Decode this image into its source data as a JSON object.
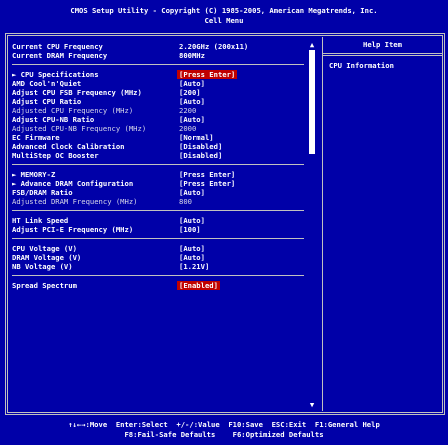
{
  "header": {
    "title": "CMOS Setup Utility - Copyright (C) 1985-2005, American Megatrends, Inc.",
    "subtitle": "Cell Menu"
  },
  "info_rows": [
    {
      "label": "Current CPU Frequency",
      "value": "2.20GHz (200x11)"
    },
    {
      "label": "Current DRAM Frequency",
      "value": "800MHz"
    }
  ],
  "group1": [
    {
      "label": "► CPU Specifications",
      "value": "[Press Enter]",
      "highlight": true
    },
    {
      "label": "AMD Cool'n'Quiet",
      "value": "[Auto]"
    },
    {
      "label": "Adjust CPU FSB Frequency (MHz)",
      "value": "[200]"
    },
    {
      "label": "Adjust CPU Ratio",
      "value": "[Auto]"
    },
    {
      "label": "Adjusted CPU Frequency (MHz)",
      "value": "2200",
      "dim": true
    },
    {
      "label": "Adjust CPU-NB Ratio",
      "value": "[Auto]"
    },
    {
      "label": "Adjusted CPU-NB Frequency (MHz)",
      "value": "2000",
      "dim": true
    },
    {
      "label": "EC Firmware",
      "value": "[Normal]"
    },
    {
      "label": "Advanced Clock Calibration",
      "value": "[Disabled]"
    },
    {
      "label": "MultiStep OC Booster",
      "value": "[Disabled]"
    }
  ],
  "group2": [
    {
      "label": "► MEMORY-Z",
      "value": "[Press Enter]"
    },
    {
      "label": "► Advance DRAM Configuration",
      "value": "[Press Enter]"
    },
    {
      "label": "FSB/DRAM Ratio",
      "value": "[Auto]"
    },
    {
      "label": "Adjusted DRAM Frequency (MHz)",
      "value": "800",
      "dim": true
    }
  ],
  "group3": [
    {
      "label": "HT Link Speed",
      "value": "[Auto]"
    },
    {
      "label": "Adjust PCI-E Frequency (MHz)",
      "value": "[100]"
    }
  ],
  "group4": [
    {
      "label": "CPU Voltage (V)",
      "value": "[Auto]"
    },
    {
      "label": "DRAM Voltage (V)",
      "value": "[Auto]"
    },
    {
      "label": "NB Voltage (V)",
      "value": "[1.21V]"
    }
  ],
  "group5": [
    {
      "label": "Spread Spectrum",
      "value": "[Enabled]",
      "highlight": true
    }
  ],
  "help": {
    "title": "Help Item",
    "text": "CPU Information"
  },
  "scroll": {
    "up": "▲",
    "down": "▼"
  },
  "footer": {
    "line1": "↑↓←→:Move  Enter:Select  +/-/:Value  F10:Save  ESC:Exit  F1:General Help",
    "line2": "F8:Fail-Safe Defaults    F6:Optimized Defaults"
  },
  "colors": {
    "background": "#0000a8",
    "highlight": "#c00000",
    "text": "#ffffff"
  }
}
